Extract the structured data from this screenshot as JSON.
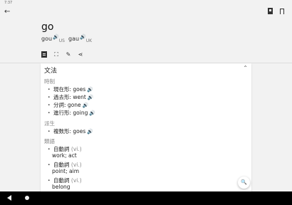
{
  "status": {
    "time": "7:37"
  },
  "appbar": {
    "back_icon": "back-arrow-icon",
    "bookmark_icons": [
      "bookmark-filled-icon",
      "bookmark-outline-icon"
    ]
  },
  "entry": {
    "word": "go",
    "pron_us": "gou",
    "region_us": "US",
    "pron_uk": "gau",
    "region_uk": "UK",
    "speaker_glyph": "🔊"
  },
  "tools": {
    "doc_icon": "document-icon",
    "expand_icon": "expand-icon",
    "note_icon": "note-icon",
    "share_glyph": "⋖",
    "expand_glyph": "⛶",
    "note_glyph": "✎"
  },
  "card": {
    "title": "文法",
    "chevron": "⌃",
    "bullet": "・",
    "sections": {
      "conjugation": "時制",
      "derivation": "派生",
      "synonyms": "類語"
    },
    "conjugations": [
      {
        "label": "現在形: goes"
      },
      {
        "label": "過去形: went"
      },
      {
        "label": "分詞: gone"
      },
      {
        "label": "進行形: going"
      }
    ],
    "derived": [
      {
        "label": "複数形: goes"
      }
    ],
    "synonyms": [
      {
        "head": "自動詞",
        "pos": "(vi.)",
        "gloss": "work; act"
      },
      {
        "head": "自動詞",
        "pos": "(vi.)",
        "gloss": "point; aim"
      },
      {
        "head": "自動詞",
        "pos": "(vi.)",
        "gloss": "belong"
      }
    ]
  },
  "fab": {
    "glyph": "🔍"
  },
  "navbar": {
    "back_icon": "nav-back-icon",
    "home_icon": "nav-home-icon"
  }
}
